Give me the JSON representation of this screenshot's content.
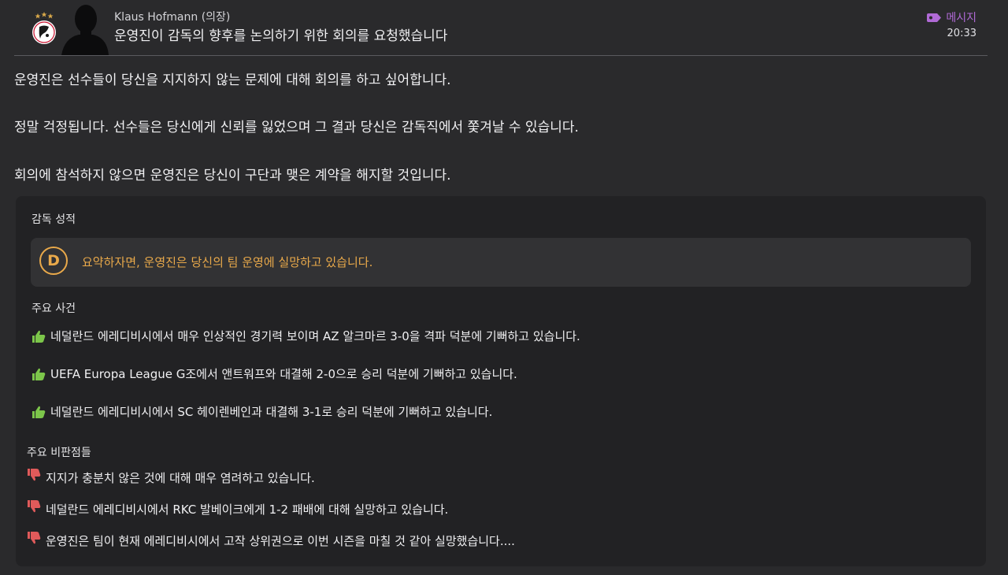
{
  "header": {
    "sender": "Klaus Hofmann (의장)",
    "subject": "운영진이 감독의 향후를 논의하기 위한 회의를 요청했습니다",
    "tag_label": "메시지",
    "tag_color": "#b06ad6",
    "time": "20:33"
  },
  "body": {
    "paragraphs": [
      "운영진은 선수들이 당신을 지지하지 않는 문제에 대해 회의를 하고 싶어합니다.",
      "정말 걱정됩니다. 선수들은 당신에게 신뢰를 잃었으며 그 결과 당신은 감독직에서 쫓겨날 수 있습니다.",
      "회의에 참석하지 않으면 운영진은 당신이 구단과 맺은 계약을 해지할 것입니다."
    ]
  },
  "card": {
    "performance_title": "감독 성적",
    "grade": "D",
    "grade_color": "#e9a94a",
    "grade_summary": "요약하자면, 운영진은 당신의 팀 운영에 실망하고 있습니다.",
    "key_events_title": "주요 사건",
    "key_events": [
      "네덜란드 에레디비시에서 매우 인상적인 경기력 보이며 AZ 알크마르 3-0을 격파 덕분에 기뻐하고 있습니다.",
      "UEFA Europa League G조에서 앤트워프와 대결해 2-0으로 승리 덕분에 기뻐하고 있습니다.",
      "네덜란드 에레디비시에서 SC 헤이렌베인과 대결해 3-1로 승리 덕분에 기뻐하고 있습니다."
    ],
    "criticisms_title": "주요 비판점들",
    "criticisms": [
      "지지가 충분치 않은 것에 대해 매우 염려하고 있습니다.",
      "네덜란드 에레디비시에서 RKC 발베이크에게 1-2 패배에 대해 실망하고 있습니다.",
      "운영진은 팀이 현재 에레디비시에서 고작 상위권으로 이번 시즌을 마칠 것 같아 실망했습니다...."
    ],
    "positive_color": "#7cc64a",
    "negative_color": "#e05a5a"
  }
}
